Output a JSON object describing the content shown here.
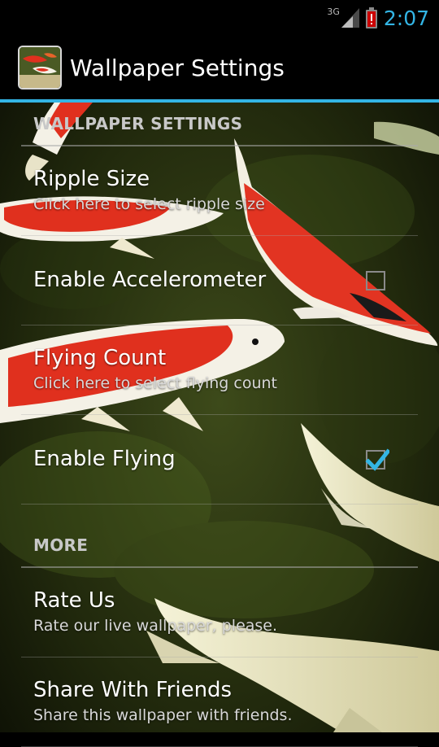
{
  "status_bar": {
    "network_label": "3G",
    "clock": "2:07"
  },
  "action_bar": {
    "title": "Wallpaper Settings"
  },
  "sections": [
    {
      "header": "WALLPAPER SETTINGS",
      "items": [
        {
          "title": "Ripple Size",
          "summary": "Click here to select ripple size",
          "has_checkbox": false
        },
        {
          "title": "Enable Accelerometer",
          "summary": "",
          "has_checkbox": true,
          "checked": false
        },
        {
          "title": "Flying Count",
          "summary": "Click here to select flying count",
          "has_checkbox": false
        },
        {
          "title": "Enable Flying",
          "summary": "",
          "has_checkbox": true,
          "checked": true
        }
      ]
    },
    {
      "header": "MORE",
      "items": [
        {
          "title": "Rate Us",
          "summary": "Rate our live wallpaper, please.",
          "has_checkbox": false
        },
        {
          "title": "Share With Friends",
          "summary": "Share this wallpaper with friends.",
          "has_checkbox": false
        }
      ]
    }
  ],
  "colors": {
    "accent": "#33b5e5",
    "battery_alert": "#cc0000"
  }
}
